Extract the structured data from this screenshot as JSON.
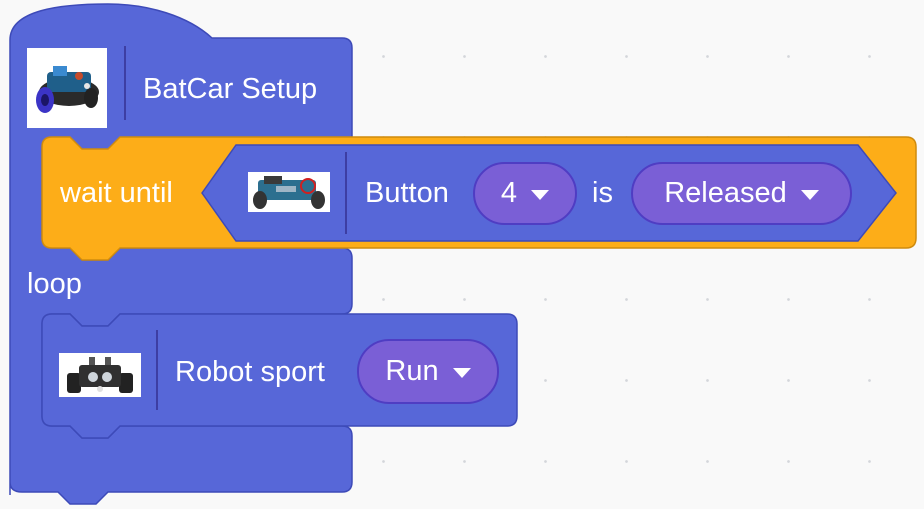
{
  "blocks": {
    "setup": {
      "label": "BatCar Setup",
      "icon": "robot-car-icon"
    },
    "wait_until": {
      "label": "wait until",
      "condition": {
        "button_label": "Button",
        "button_value": "4",
        "is_label": "is",
        "state_value": "Released",
        "icon": "robot-car-button-icon"
      }
    },
    "loop": {
      "label": "loop"
    },
    "robot_sport": {
      "label": "Robot sport",
      "value": "Run",
      "icon": "robot-car-front-icon"
    }
  },
  "colors": {
    "event_block": "#5767d8",
    "event_border": "#3d4ab8",
    "control_block": "#fdad18",
    "control_border": "#cf8b0e",
    "dropdown_pill": "#7a5fd6",
    "canvas_background": "#f9f9f9"
  }
}
